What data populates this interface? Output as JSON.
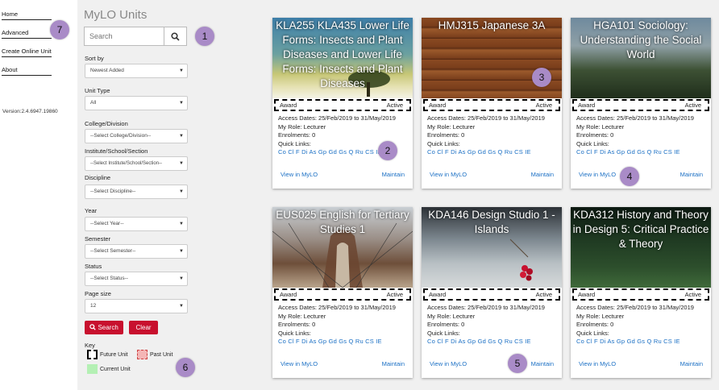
{
  "nav": {
    "items": [
      "Home",
      "Advanced",
      "Create Online Unit",
      "About"
    ],
    "version": "Version:2.4.6947.19860"
  },
  "panel": {
    "title": "MyLO Units",
    "search_placeholder": "Search",
    "filters": [
      {
        "label": "Sort by",
        "value": "Newest Added"
      },
      {
        "label": "Unit Type",
        "value": "All"
      },
      {
        "label": "College/Division",
        "value": "--Select College/Division--"
      },
      {
        "label": "Institute/School/Section",
        "value": "--Select Institute/School/Section--"
      },
      {
        "label": "Discipline",
        "value": "--Select Discipline--"
      },
      {
        "label": "Year",
        "value": "--Select Year--"
      },
      {
        "label": "Semester",
        "value": "--Select Semester--"
      },
      {
        "label": "Status",
        "value": "--Select Status--"
      },
      {
        "label": "Page size",
        "value": "12"
      }
    ],
    "search_button": "Search",
    "clear_button": "Clear",
    "key_label": "Key",
    "key_items": [
      "Future Unit",
      "Past Unit",
      "Current Unit"
    ]
  },
  "common": {
    "award": "Award",
    "status": "Active",
    "access_dates": "Access Dates: 25/Feb/2019 to 31/May/2019",
    "role": "My Role: Lecturer",
    "enrolments": "Enrolments: 0",
    "quick_links_label": "Quick Links:",
    "quick_links": "Co Cl F Di As Gp Gd Gs Q Ru CS IE",
    "view_link": "View in MyLO",
    "maintain_link": "Maintain"
  },
  "cards": [
    {
      "title": "KLA255 KLA435 Lower Life Forms: Insects and Plant Diseases and Lower Life Forms: Insects and Plant Diseases"
    },
    {
      "title": "HMJ315 Japanese 3A"
    },
    {
      "title": "HGA101 Sociology: Understanding the Social World"
    },
    {
      "title": "EUS025 English for Tertiary Studies 1"
    },
    {
      "title": "KDA146 Design Studio 1 - Islands"
    },
    {
      "title": "KDA312 History and Theory in Design 5: Critical Practice & Theory"
    }
  ],
  "badges": [
    "1",
    "2",
    "3",
    "4",
    "5",
    "6",
    "7"
  ],
  "colors": {
    "accent_red": "#c8102e",
    "link_blue": "#1a6fc4",
    "badge_purple": "#a98bc7"
  }
}
